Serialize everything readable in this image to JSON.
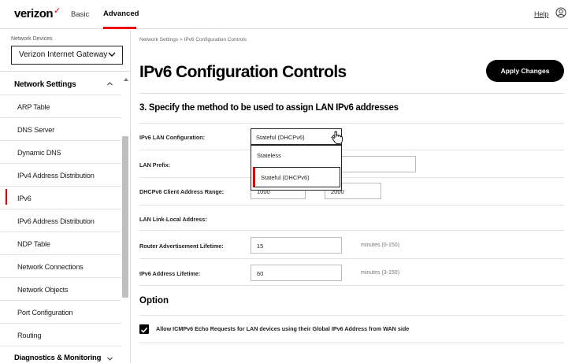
{
  "header": {
    "logo": "verizon",
    "nav_basic": "Basic",
    "nav_advanced": "Advanced",
    "help": "Help",
    "accent_color": "#ee0000"
  },
  "sidebar": {
    "device_label": "Network Devices",
    "device_selected": "Verizon Internet Gateway",
    "section_title": "Network Settings",
    "items": [
      {
        "label": "ARP Table"
      },
      {
        "label": "DNS Server"
      },
      {
        "label": "Dynamic DNS"
      },
      {
        "label": "IPv4 Address Distribution"
      },
      {
        "label": "IPv6",
        "active": true
      },
      {
        "label": "IPv6 Address Distribution"
      },
      {
        "label": "NDP Table"
      },
      {
        "label": "Network Connections"
      },
      {
        "label": "Network Objects"
      },
      {
        "label": "Port Configuration"
      },
      {
        "label": "Routing"
      }
    ],
    "next_section": "Diagnostics & Monitoring"
  },
  "main": {
    "breadcrumb": "Network Settings > IPv6 Configuration Controls",
    "title": "IPv6 Configuration Controls",
    "apply_button": "Apply Changes",
    "section_heading": "3. Specify the method to be used to assign LAN IPv6 addresses",
    "lan_config": {
      "label": "IPv6 LAN Configuration:",
      "value": "Stateful (DHCPv6)",
      "options": [
        "Stateless",
        "Stateful (DHCPv6)"
      ]
    },
    "lan_prefix": {
      "label": "LAN Prefix:",
      "value": ""
    },
    "dhcp_range": {
      "label": "DHCPv6 Client Address Range:",
      "from": "1000",
      "to": "2000"
    },
    "link_local": {
      "label": "LAN Link-Local Address:"
    },
    "router_adv": {
      "label": "Router Advertisement Lifetime:",
      "value": "15",
      "hint": "minutes (0-150)"
    },
    "addr_lifetime": {
      "label": "IPv6 Address Lifetime:",
      "value": "60",
      "hint": "minutes (3-150)"
    },
    "option_title": "Option",
    "icmp_checkbox": {
      "label": "Allow ICMPv6 Echo Requests for LAN devices using their Global IPv6 Address from WAN side",
      "checked": true
    }
  }
}
